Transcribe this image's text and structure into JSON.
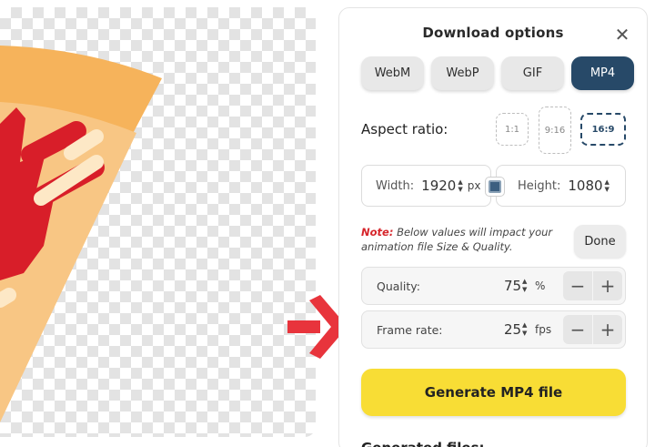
{
  "panel": {
    "title": "Download options",
    "close_icon": "close-icon"
  },
  "formats": {
    "items": [
      "WebM",
      "WebP",
      "GIF",
      "MP4"
    ],
    "selected": "MP4"
  },
  "aspect": {
    "label": "Aspect ratio:",
    "options": [
      "1:1",
      "9:16",
      "16:9"
    ],
    "selected": "16:9"
  },
  "dimensions": {
    "width_label": "Width:",
    "width_value": "1920",
    "width_unit": "px",
    "height_label": "Height:",
    "height_value": "1080",
    "lock_icon": "lock-aspect-icon"
  },
  "note": {
    "head": "Note:",
    "text": " Below values will impact your animation file Size & Quality."
  },
  "done_label": "Done",
  "quality": {
    "label": "Quality:",
    "value": "75",
    "unit": "%"
  },
  "frame_rate": {
    "label": "Frame rate:",
    "value": "25",
    "unit": "fps"
  },
  "generate_label": "Generate MP4 file",
  "generated_files_label": "Generated files:",
  "colors": {
    "accent": "#274968",
    "generate": "#f8dd35",
    "arrow": "#e8343c",
    "note_head": "#d6262c"
  }
}
